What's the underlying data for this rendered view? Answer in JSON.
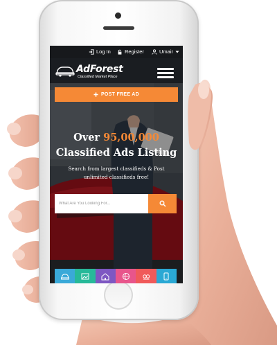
{
  "topbar": {
    "login_label": "Log In",
    "register_label": "Register",
    "user_label": "Umair"
  },
  "brand": {
    "title": "AdForest",
    "subtitle": "Classified Market Place"
  },
  "post_button": {
    "label": "POST FREE AD"
  },
  "hero": {
    "headline_prefix": "Over",
    "headline_count": "95,00,000",
    "headline_line2": "Classified Ads Listing",
    "subtext": "Search from largest classifieds & Post unlimited classifieds free!"
  },
  "search": {
    "placeholder": "What Are You Looking For..."
  },
  "categories": [
    {
      "icon": "car-icon",
      "color": "#3aa9d8"
    },
    {
      "icon": "image-icon",
      "color": "#27b999"
    },
    {
      "icon": "house-icon",
      "color": "#7e57c2"
    },
    {
      "icon": "ball-icon",
      "color": "#e8558b"
    },
    {
      "icon": "pet-icon",
      "color": "#f05a5a"
    },
    {
      "icon": "phone-icon",
      "color": "#2aa8d4"
    }
  ],
  "colors": {
    "accent": "#f58936",
    "topbar": "#17191c",
    "header": "#14161a"
  }
}
